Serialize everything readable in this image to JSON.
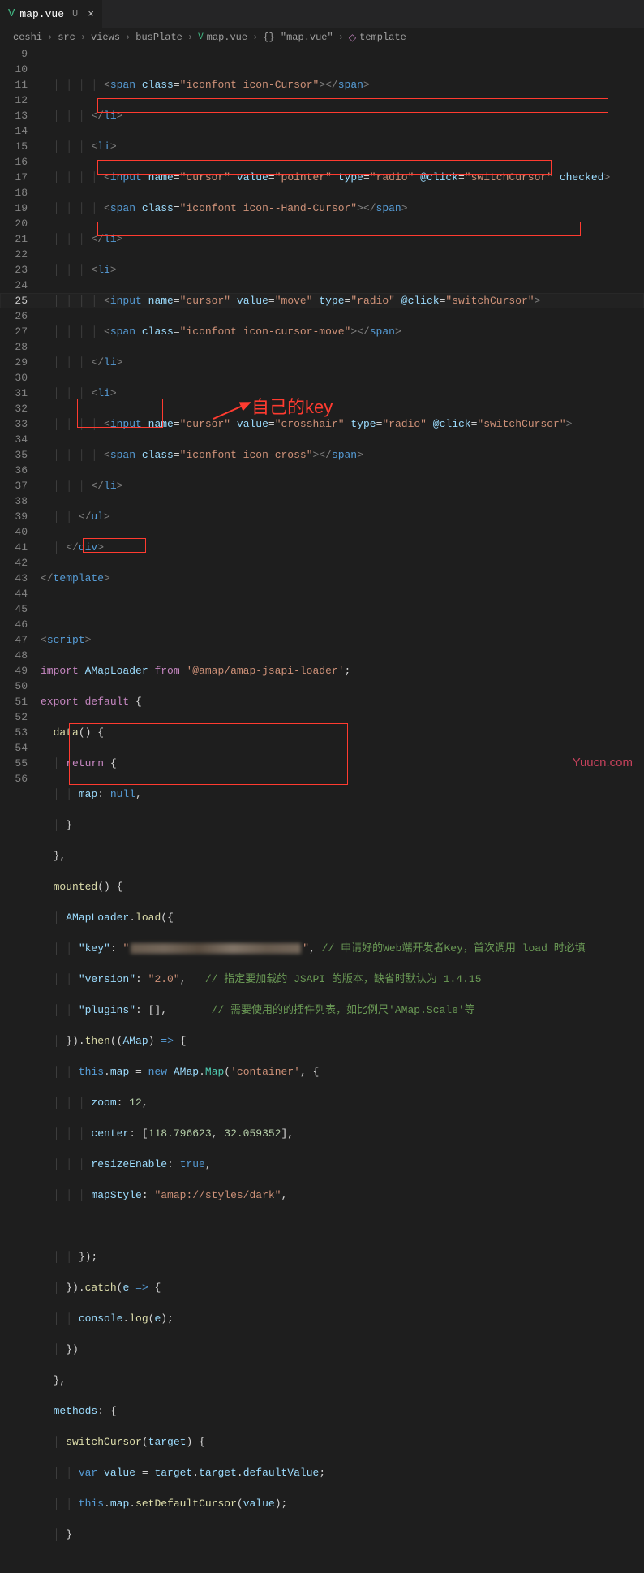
{
  "tab": {
    "icon": "V",
    "filename": "map.vue",
    "status": "U"
  },
  "breadcrumb": {
    "items": [
      "ceshi",
      "src",
      "views",
      "busPlate",
      "map.vue",
      "{} \"map.vue\"",
      "template"
    ]
  },
  "lines": {
    "start": 9,
    "end": 56,
    "active": 25
  },
  "code": {
    "l9a": "<",
    "l9b": "span",
    "l9c": " class",
    "l9d": "=",
    "l9e": "\"iconfont icon-Cursor\"",
    "l9f": "></",
    "l9g": "span",
    "l9h": ">",
    "l10a": "</",
    "l10b": "li",
    "l10c": ">",
    "l11a": "<",
    "l11b": "li",
    "l11c": ">",
    "l12a": "<",
    "l12b": "input",
    "l12c": " name",
    "l12d": "=",
    "l12e": "\"cursor\"",
    "l12f": " value",
    "l12g": "\"pointer\"",
    "l12h": " type",
    "l12i": "\"radio\"",
    "l12j": " @click",
    "l12k": "\"switchCursor\"",
    "l12l": " checked",
    "l12m": ">",
    "l13a": "<",
    "l13b": "span",
    "l13c": " class",
    "l13d": "=",
    "l13e": "\"iconfont icon--Hand-Cursor\"",
    "l13f": "></",
    "l13g": "span",
    "l13h": ">",
    "l14a": "</",
    "l14b": "li",
    "l14c": ">",
    "l15a": "<",
    "l15b": "li",
    "l15c": ">",
    "l16a": "<",
    "l16b": "input",
    "l16c": " name",
    "l16d": "=",
    "l16e": "\"cursor\"",
    "l16f": " value",
    "l16g": "\"move\"",
    "l16h": " type",
    "l16i": "\"radio\"",
    "l16j": " @click",
    "l16k": "\"switchCursor\"",
    "l16m": ">",
    "l17a": "<",
    "l17b": "span",
    "l17c": " class",
    "l17d": "=",
    "l17e": "\"iconfont icon-cursor-move\"",
    "l17f": "></",
    "l17g": "span",
    "l17h": ">",
    "l18a": "</",
    "l18b": "li",
    "l18c": ">",
    "l19a": "<",
    "l19b": "li",
    "l19c": ">",
    "l20a": "<",
    "l20b": "input",
    "l20c": " name",
    "l20d": "=",
    "l20e": "\"cursor\"",
    "l20f": " value",
    "l20g": "\"crosshair\"",
    "l20h": " type",
    "l20i": "\"radio\"",
    "l20j": " @click",
    "l20k": "\"switchCursor\"",
    "l20m": ">",
    "l21a": "<",
    "l21b": "span",
    "l21c": " class",
    "l21d": "=",
    "l21e": "\"iconfont icon-cross\"",
    "l21f": "></",
    "l21g": "span",
    "l21h": ">",
    "l22a": "</",
    "l22b": "li",
    "l22c": ">",
    "l23a": "</",
    "l23b": "ul",
    "l23c": ">",
    "l24a": "</",
    "l24b": "div",
    "l24c": ">",
    "l25a": "</",
    "l25b": "template",
    "l25c": ">",
    "l27a": "<",
    "l27b": "script",
    "l27c": ">",
    "l28a": "import",
    "l28b": " AMapLoader ",
    "l28c": "from",
    "l28d": " '@amap/amap-jsapi-loader'",
    "l28e": ";",
    "l29a": "export",
    "l29b": " default",
    "l29c": " {",
    "l30a": "data",
    "l30b": "() {",
    "l31a": "return",
    "l31b": " {",
    "l32a": "map",
    "l32b": ": ",
    "l32c": "null",
    "l32d": ",",
    "l33a": "}",
    "l34a": "},",
    "l35a": "mounted",
    "l35b": "() {",
    "l36a": "AMapLoader",
    "l36b": ".",
    "l36c": "load",
    "l36d": "({",
    "l37a": "\"key\"",
    "l37b": ": ",
    "l37q": "\"",
    "l37c": ", ",
    "l37d": "// 申请好的Web端开发者Key，首次调用 load 时必填",
    "l38a": "\"version\"",
    "l38b": ": ",
    "l38c": "\"2.0\"",
    "l38d": ",   ",
    "l38e": "// 指定要加载的 JSAPI 的版本，缺省时默认为 1.4.15",
    "l39a": "\"plugins\"",
    "l39b": ": [],       ",
    "l39c": "// 需要使用的的插件列表，如比例尺'AMap.Scale'等",
    "l40a": "}).",
    "l40b": "then",
    "l40c": "((",
    "l40d": "AMap",
    "l40e": ") ",
    "l40f": "=>",
    "l40g": " {",
    "l41a": "this",
    "l41b": ".",
    "l41c": "map",
    "l41d": " = ",
    "l41e": "new",
    "l41f": " AMap",
    "l41g": ".",
    "l41h": "Map",
    "l41i": "(",
    "l41j": "'container'",
    "l41k": ", {",
    "l42a": "zoom",
    "l42b": ": ",
    "l42c": "12",
    "l42d": ",",
    "l43a": "center",
    "l43b": ": [",
    "l43c": "118.796623",
    "l43d": ", ",
    "l43e": "32.059352",
    "l43f": "],",
    "l44a": "resizeEnable",
    "l44b": ": ",
    "l44c": "true",
    "l44d": ",",
    "l45a": "mapStyle",
    "l45b": ": ",
    "l45c": "\"amap://styles/dark\"",
    "l45d": ",",
    "l47a": "});",
    "l48a": "}).",
    "l48b": "catch",
    "l48c": "(",
    "l48d": "e",
    "l48e": " => ",
    "l48f": "{",
    "l49a": "console",
    "l49b": ".",
    "l49c": "log",
    "l49d": "(",
    "l49e": "e",
    "l49f": ");",
    "l50a": "})",
    "l51a": "},",
    "l52a": "methods",
    "l52b": ": {",
    "l53a": "switchCursor",
    "l53b": "(",
    "l53c": "target",
    "l53d": ") {",
    "l54a": "var",
    "l54b": " value",
    "l54c": " = ",
    "l54d": "target",
    "l54e": ".",
    "l54f": "target",
    "l54g": ".",
    "l54h": "defaultValue",
    "l54i": ";",
    "l55a": "this",
    "l55b": ".",
    "l55c": "map",
    "l55d": ".",
    "l55e": "setDefaultCursor",
    "l55f": "(",
    "l55g": "value",
    "l55h": ");",
    "l56a": "}"
  },
  "annotation": "自己的key",
  "watermark": "Yuucn.com"
}
